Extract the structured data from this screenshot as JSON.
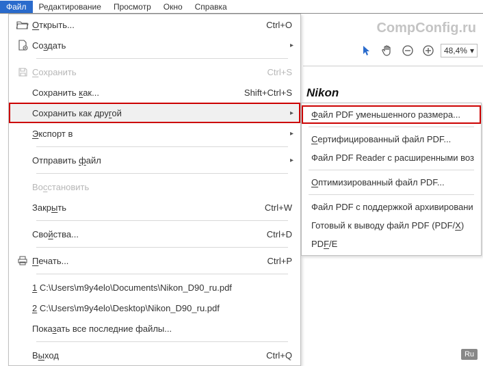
{
  "menubar": {
    "items": [
      "Файл",
      "Редактирование",
      "Просмотр",
      "Окно",
      "Справка"
    ],
    "active_index": 0
  },
  "watermark": "CompConfig.ru",
  "brand": "Nikon",
  "toolbar": {
    "zoom_value": "48,4%",
    "zoom_arrow": "▾"
  },
  "ru_badge": "Ru",
  "file_menu": {
    "open": {
      "label_pre": "",
      "label_u": "О",
      "label_post": "ткрыть...",
      "shortcut": "Ctrl+O"
    },
    "create": {
      "label": "Создать",
      "label_u": "з"
    },
    "save": {
      "label_pre": "",
      "label_u": "С",
      "label_post": "охранить",
      "shortcut": "Ctrl+S"
    },
    "save_as": {
      "label_pre": "Сохранить ",
      "label_u": "к",
      "label_post": "ак...",
      "shortcut": "Shift+Ctrl+S"
    },
    "save_as_other": {
      "label_pre": "Сохранить как дру",
      "label_u": "г",
      "label_post": "ой"
    },
    "export": {
      "label_pre": "",
      "label_u": "Э",
      "label_post": "кспорт в"
    },
    "send": {
      "label_pre": "Отправить ",
      "label_u": "ф",
      "label_post": "айл"
    },
    "restore": {
      "label_pre": "Во",
      "label_u": "с",
      "label_post": "становить"
    },
    "close": {
      "label_pre": "Закр",
      "label_u": "ы",
      "label_post": "ть",
      "shortcut": "Ctrl+W"
    },
    "properties": {
      "label_pre": "Сво",
      "label_u": "й",
      "label_post": "ства...",
      "shortcut": "Ctrl+D"
    },
    "print": {
      "label_pre": "",
      "label_u": "П",
      "label_post": "ечать...",
      "shortcut": "Ctrl+P"
    },
    "recent1": {
      "pre": "",
      "u": "1",
      "post": " C:\\Users\\m9y4elo\\Documents\\Nikon_D90_ru.pdf"
    },
    "recent2": {
      "pre": "",
      "u": "2",
      "post": " C:\\Users\\m9y4elo\\Desktop\\Nikon_D90_ru.pdf"
    },
    "show_all": {
      "label_pre": "Пока",
      "label_u": "з",
      "label_post": "ать все последние файлы..."
    },
    "exit": {
      "label_pre": "В",
      "label_u": "ы",
      "label_post": "ход",
      "shortcut": "Ctrl+Q"
    }
  },
  "submenu": {
    "reduced": {
      "pre": "",
      "u": "Ф",
      "post": "айл PDF уменьшенного размера..."
    },
    "certified": {
      "pre": "",
      "u": "С",
      "post": "ертифицированный файл PDF..."
    },
    "reader_ext": {
      "text": "Файл PDF Reader с расширенными воз"
    },
    "optimized": {
      "pre": "",
      "u": "О",
      "post": "птимизированный файл PDF..."
    },
    "archive": {
      "text": "Файл PDF с поддержкой архивировани"
    },
    "print_ready": {
      "pre": "Готовый к выводу файл PDF (PDF/",
      "u": "X",
      "post": ")"
    },
    "pdfe": {
      "pre": "PD",
      "u": "F",
      "post": "/E"
    }
  }
}
